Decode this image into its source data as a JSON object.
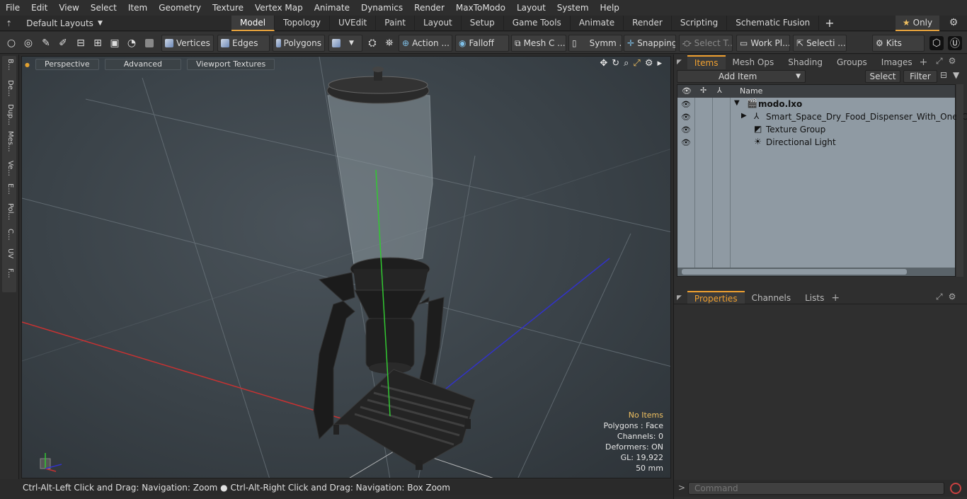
{
  "menu": [
    "File",
    "Edit",
    "View",
    "Select",
    "Item",
    "Geometry",
    "Texture",
    "Vertex Map",
    "Animate",
    "Dynamics",
    "Render",
    "MaxToModo",
    "Layout",
    "System",
    "Help"
  ],
  "layouts_label": "Default Layouts",
  "tabs": [
    "Model",
    "Topology",
    "UVEdit",
    "Paint",
    "Layout",
    "Setup",
    "Game Tools",
    "Animate",
    "Render",
    "Scripting",
    "Schematic Fusion"
  ],
  "only_label": "Only",
  "toolbar": {
    "vertices": "Vertices",
    "edges": "Edges",
    "polygons": "Polygons",
    "action": "Action ...",
    "falloff": "Falloff",
    "mesh": "Mesh C ...",
    "symm": "Symm ...",
    "snapping": "Snapping",
    "select_t": "Select T...",
    "work_pl": "Work Pl...",
    "selecti": "Selecti ...",
    "kits": "Kits"
  },
  "left_tabs": [
    "B...",
    "De...",
    "Dup...",
    "Mes...",
    "Ve...",
    "E...",
    "Pol...",
    "C...",
    "UV",
    "F..."
  ],
  "viewport": {
    "perspective": "Perspective",
    "advanced": "Advanced",
    "textures": "Viewport Textures",
    "stats": {
      "no_items": "No Items",
      "polygons": "Polygons : Face",
      "channels": "Channels: 0",
      "deformers": "Deformers: ON",
      "gl": "GL: 19,922",
      "scale": "50 mm"
    }
  },
  "status": "Ctrl-Alt-Left Click and Drag: Navigation: Zoom ● Ctrl-Alt-Right Click and Drag: Navigation: Box Zoom",
  "panel": {
    "tabs": [
      "Items",
      "Mesh Ops",
      "Shading",
      "Groups",
      "Images"
    ],
    "add_item": "Add Item",
    "select": "Select",
    "filter": "Filter",
    "name_header": "Name",
    "items": [
      {
        "label": "modo.lxo"
      },
      {
        "label": "Smart_Space_Dry_Food_Dispenser_With_One_Cani..."
      },
      {
        "label": "Texture Group"
      },
      {
        "label": "Directional Light"
      }
    ],
    "props_tabs": [
      "Properties",
      "Channels",
      "Lists"
    ],
    "command_placeholder": "Command"
  },
  "colors": {
    "accent": "#f0a030",
    "x_axis": "#c83232",
    "y_axis": "#32c832",
    "z_axis": "#3232c8"
  }
}
